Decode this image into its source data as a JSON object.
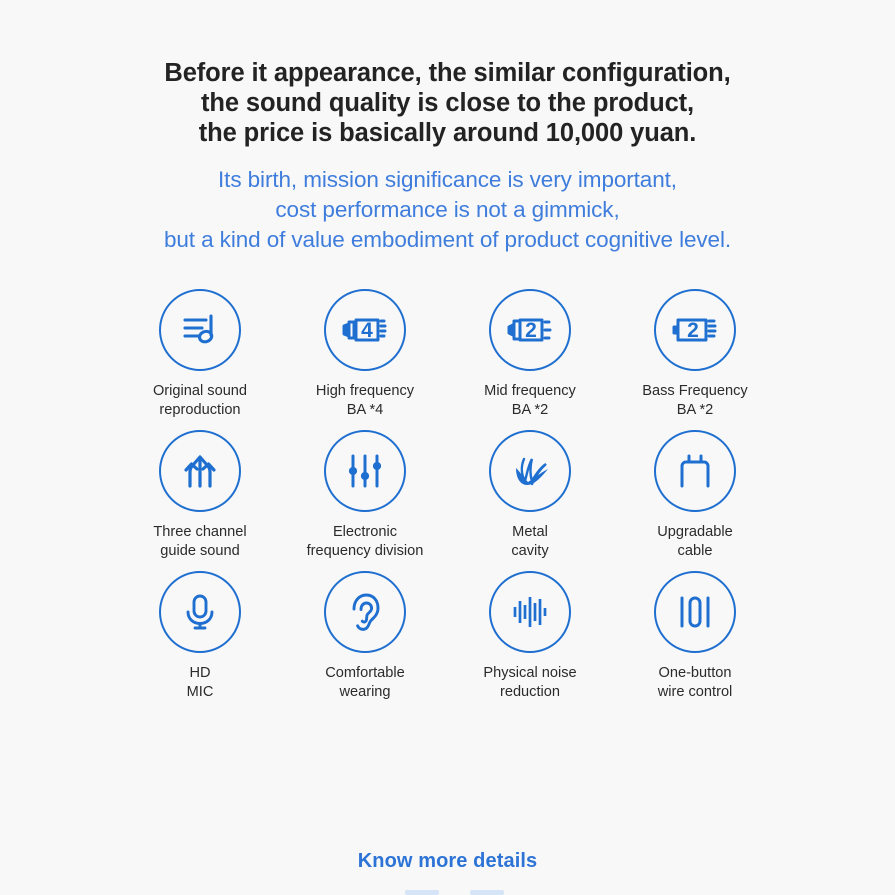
{
  "colors": {
    "background": "#f8f8f8",
    "headline_text": "#232323",
    "accent_blue": "#3f7ddd",
    "icon_blue": "#1f6fd0",
    "link_blue": "#2d74d6"
  },
  "headline": {
    "line1": "Before it appearance, the similar configuration,",
    "line2": "the sound quality is close to the product,",
    "line3": "the price is basically around 10,000 yuan."
  },
  "subhead": {
    "line1": "Its birth, mission significance is very important,",
    "line2": "cost performance is not a gimmick,",
    "line3": "but a kind of value embodiment of product cognitive level."
  },
  "features": [
    {
      "icon": "music-note-lines-icon",
      "label": "Original sound\nreproduction"
    },
    {
      "icon": "ba-driver-4-icon",
      "label": "High frequency\nBA *4"
    },
    {
      "icon": "ba-driver-2-mid-icon",
      "label": "Mid frequency\nBA *2"
    },
    {
      "icon": "ba-driver-2-bass-icon",
      "label": "Bass Frequency\nBA *2"
    },
    {
      "icon": "three-arrows-icon",
      "label": "Three channel\nguide sound"
    },
    {
      "icon": "equalizer-sliders-icon",
      "label": "Electronic\nfrequency division"
    },
    {
      "icon": "metal-swoosh-icon",
      "label": "Metal\ncavity"
    },
    {
      "icon": "two-pin-connector-icon",
      "label": "Upgradable\ncable"
    },
    {
      "icon": "microphone-icon",
      "label": "HD\nMIC"
    },
    {
      "icon": "ear-icon",
      "label": "Comfortable\nwearing"
    },
    {
      "icon": "waveform-bars-icon",
      "label": "Physical noise\nreduction"
    },
    {
      "icon": "wire-control-button-icon",
      "label": "One-button\nwire control"
    }
  ],
  "footer": {
    "more_link": "Know more details"
  }
}
